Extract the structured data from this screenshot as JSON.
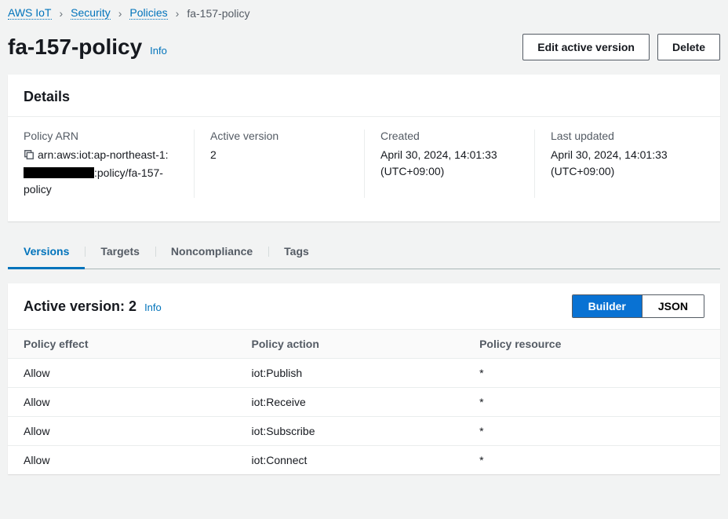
{
  "breadcrumb": {
    "items": [
      "AWS IoT",
      "Security",
      "Policies"
    ],
    "current": "fa-157-policy"
  },
  "header": {
    "title": "fa-157-policy",
    "info": "Info",
    "edit_btn": "Edit active version",
    "delete_btn": "Delete"
  },
  "details": {
    "panel_title": "Details",
    "arn_label": "Policy ARN",
    "arn_prefix": "arn:aws:iot:ap-northeast-1:",
    "arn_suffix": ":policy/fa-157-policy",
    "active_version_label": "Active version",
    "active_version_value": "2",
    "created_label": "Created",
    "created_value": "April 30, 2024, 14:01:33 (UTC+09:00)",
    "updated_label": "Last updated",
    "updated_value": "April 30, 2024, 14:01:33 (UTC+09:00)"
  },
  "tabs": {
    "versions": "Versions",
    "targets": "Targets",
    "noncompliance": "Noncompliance",
    "tags": "Tags"
  },
  "version": {
    "title": "Active version: 2",
    "info": "Info",
    "builder": "Builder",
    "json": "JSON",
    "col_effect": "Policy effect",
    "col_action": "Policy action",
    "col_resource": "Policy resource",
    "rows": [
      {
        "effect": "Allow",
        "action": "iot:Publish",
        "resource": "*"
      },
      {
        "effect": "Allow",
        "action": "iot:Receive",
        "resource": "*"
      },
      {
        "effect": "Allow",
        "action": "iot:Subscribe",
        "resource": "*"
      },
      {
        "effect": "Allow",
        "action": "iot:Connect",
        "resource": "*"
      }
    ]
  }
}
